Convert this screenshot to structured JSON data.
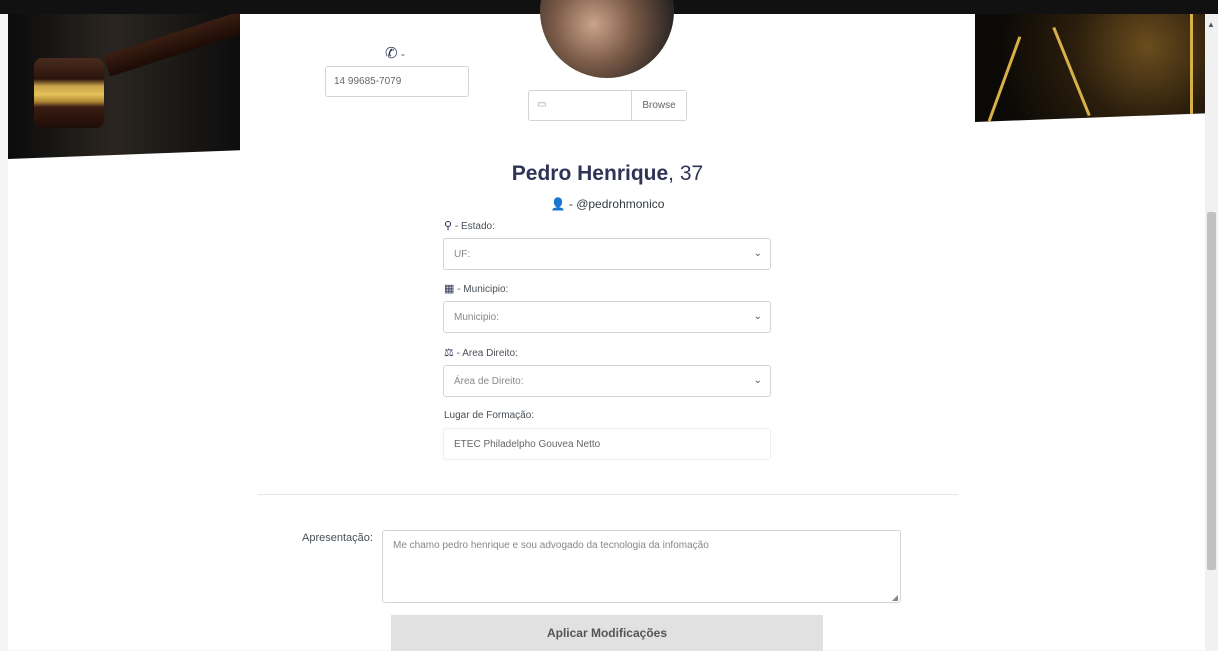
{
  "profile": {
    "phone_label": "-",
    "phone_value": "14 99685-7079",
    "file_browse_label": "Browse",
    "name": "Pedro Henrique",
    "age_text": ", 37",
    "username_text": "- @pedrohmonico"
  },
  "form": {
    "estado": {
      "label": "- Estado:",
      "selected": "UF:"
    },
    "municipio": {
      "label": "- Municipio:",
      "selected": "Municipio:"
    },
    "area": {
      "label": "- Area Direito:",
      "selected": "Área de Direito:"
    },
    "formacao": {
      "label": "Lugar de Formação:",
      "value": "ETEC Philadelpho Gouvea Netto"
    },
    "apresentacao": {
      "label": "Apresentação:",
      "value": "Me chamo pedro henrique e sou advogado da tecnologia da infomação"
    },
    "submit_label": "Aplicar Modificações"
  },
  "icons": {
    "phone": "phone-icon",
    "image": "image-icon",
    "user": "user-icon",
    "map_marker": "map-marker-icon",
    "map": "map-icon",
    "balance": "balance-scale-icon",
    "chevron": "chevron-down-icon"
  },
  "colors": {
    "accent": "#2f3356",
    "button_bg": "#e1e1e1"
  }
}
